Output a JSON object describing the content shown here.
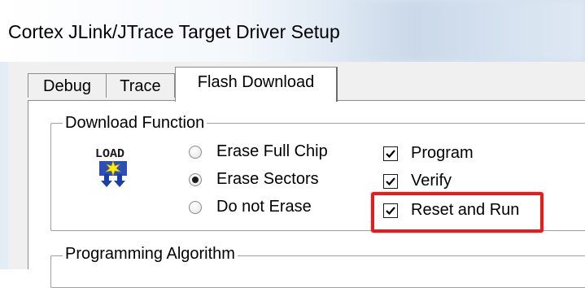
{
  "window": {
    "title": "Cortex JLink/JTrace Target Driver Setup"
  },
  "tabs": [
    {
      "label": "Debug",
      "active": false
    },
    {
      "label": "Trace",
      "active": false
    },
    {
      "label": "Flash Download",
      "active": true
    }
  ],
  "download_function": {
    "label": "Download Function",
    "icon": "load-icon",
    "icon_text": "LOAD",
    "radios": [
      {
        "label": "Erase Full Chip",
        "checked": false
      },
      {
        "label": "Erase Sectors",
        "checked": true
      },
      {
        "label": "Do not Erase",
        "checked": false
      }
    ],
    "checkboxes": [
      {
        "label": "Program",
        "checked": true
      },
      {
        "label": "Verify",
        "checked": true
      },
      {
        "label": "Reset and Run",
        "checked": true
      }
    ]
  },
  "programming_algorithm": {
    "label": "Programming Algorithm"
  },
  "colors": {
    "highlight": "#e02020",
    "panel_bg": "#ffffff",
    "dialog_bg": "#f0f0f0"
  }
}
